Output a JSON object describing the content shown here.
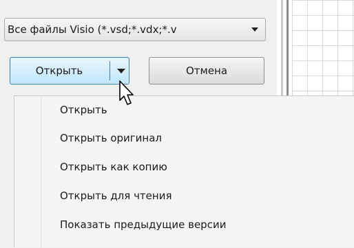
{
  "filetype": {
    "selected": "Все файлы Visio (*.vsd;*.vdx;*.v"
  },
  "buttons": {
    "open_label": "Открыть",
    "cancel_label": "Отмена"
  },
  "menu": {
    "items": [
      {
        "label": "Открыть"
      },
      {
        "label": "Открыть оригинал"
      },
      {
        "label": "Открыть как копию"
      },
      {
        "label": "Открыть для чтения"
      },
      {
        "label": "Показать предыдущие версии"
      }
    ]
  },
  "icons": {
    "cursor": "arrow-cursor-icon",
    "dropdown": "chevron-down-icon"
  }
}
